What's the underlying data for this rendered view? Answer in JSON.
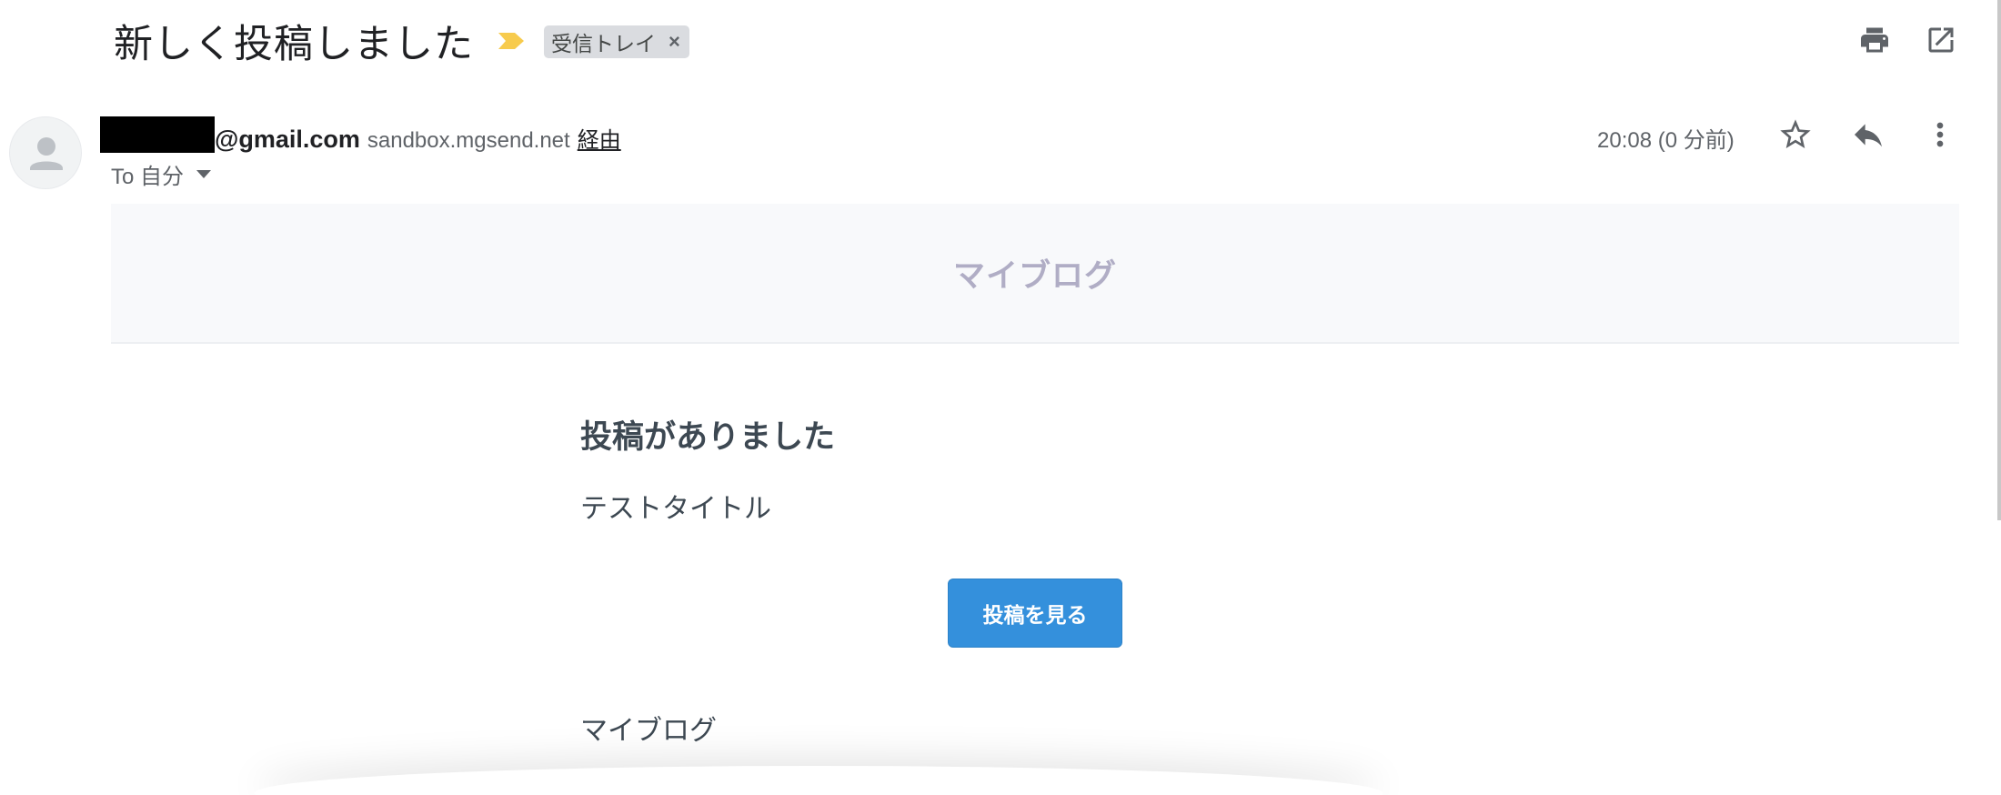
{
  "header": {
    "subject": "新しく投稿しました",
    "label": "受信トレイ",
    "label_remove": "×",
    "icons": [
      "importance-marker-icon",
      "print-icon",
      "open-in-new-window-icon"
    ],
    "accent_color": "#f7cb4d"
  },
  "message": {
    "sender_email": "@gmail.com",
    "via_domain": "sandbox.mgsend.net",
    "via_label": "経由",
    "recipient": "To 自分",
    "timestamp": "20:08 (0 分前)",
    "icons": [
      "avatar-person-icon",
      "star-icon",
      "reply-icon",
      "more-vert-icon"
    ]
  },
  "body": {
    "brand": "マイブログ",
    "heading": "投稿がありました",
    "post_title": "テストタイトル",
    "button_label": "投稿を見る",
    "signature": "マイブログ",
    "button_color": "#3490dc"
  }
}
